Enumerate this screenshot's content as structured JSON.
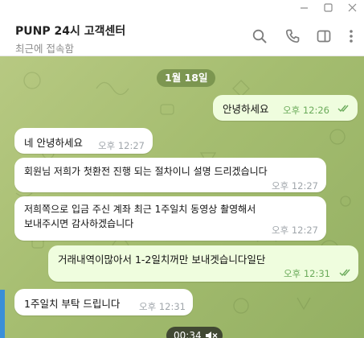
{
  "window": {
    "minimize_icon": "minimize-icon",
    "maximize_icon": "maximize-icon",
    "close_icon": "close-icon"
  },
  "header": {
    "title": "PUNP 24시 고객센터",
    "status": "최근에 접속함",
    "icons": [
      "search-icon",
      "phone-icon",
      "sidebar-icon",
      "more-vert-icon"
    ]
  },
  "chat": {
    "date_badge": "1월 18일",
    "messages": [
      {
        "direction": "out",
        "text": "안녕하세요",
        "time": "오후 12:26",
        "read": true
      },
      {
        "direction": "in",
        "text": "네 안녕하세요",
        "time": "오후 12:27"
      },
      {
        "direction": "in",
        "text": "회원님 저희가 첫환전 진행 되는 절차이니 설명 드리겠습니다",
        "time": "오후 12:27"
      },
      {
        "direction": "in",
        "text_line1": "저희쪽으로 입금 주신 계좌 최근 1주일치 동영상 촬영해서",
        "text_line2": "보내주시면 감사하겠습니다",
        "time": "오후 12:27"
      },
      {
        "direction": "out",
        "text": "거래내역이많아서 1-2일치꺼만 보내겟습니다일단",
        "time": "오후 12:31",
        "read": true
      },
      {
        "direction": "in",
        "text": "1주일치 부탁 드립니다",
        "time": "오후 12:31"
      }
    ],
    "video": {
      "duration": "00:34",
      "muted": true
    }
  },
  "colors": {
    "chat_bg": "#a5bd70",
    "outgoing_bubble": "#effdde",
    "incoming_bubble": "#ffffff",
    "outgoing_time": "#6bab5b",
    "incoming_time": "#a0a6ab",
    "date_badge_bg": "#708a46"
  }
}
